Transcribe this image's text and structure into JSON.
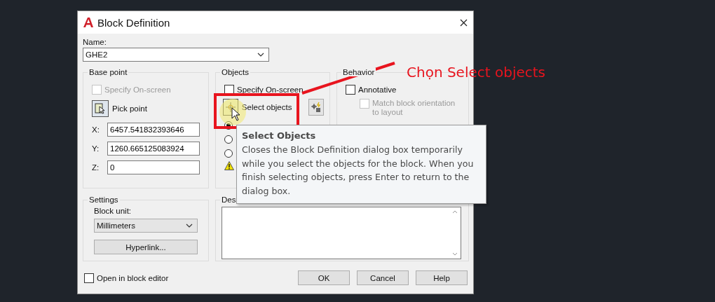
{
  "window": {
    "title": "Block Definition"
  },
  "name": {
    "label": "Name:",
    "value": "GHE2"
  },
  "base_point": {
    "title": "Base point",
    "specify_on_screen": {
      "label": "Specify On-screen",
      "checked": false,
      "disabled": true
    },
    "pick_button": "Pick point",
    "coords": [
      {
        "label": "X:",
        "value": "6457.541832393646"
      },
      {
        "label": "Y:",
        "value": "1260.665125083924"
      },
      {
        "label": "Z:",
        "value": "0"
      }
    ]
  },
  "objects": {
    "title": "Objects",
    "specify_on_screen": {
      "label": "Specify On-screen",
      "checked": false,
      "disabled": false
    },
    "select_button": "Select objects",
    "radios": [
      {
        "selected": true
      },
      {
        "selected": false
      },
      {
        "selected": false
      }
    ]
  },
  "behavior": {
    "title": "Behavior",
    "annotative": {
      "label": "Annotative",
      "checked": false,
      "disabled": false
    },
    "match_orientation": {
      "label": "Match block orientation to layout",
      "checked": false,
      "disabled": true
    }
  },
  "settings": {
    "title": "Settings",
    "unit_label": "Block unit:",
    "unit": "Millimeters",
    "hyperlink_button": "Hyperlink..."
  },
  "description": {
    "title": "Des"
  },
  "open_in_editor": {
    "label": "Open in block editor",
    "checked": false,
    "disabled": false
  },
  "buttons": [
    "OK",
    "Cancel",
    "Help"
  ],
  "tooltip": {
    "title": "Select Objects",
    "text": "Closes the Block Definition dialog box temporarily while you select the objects for the block. When you finish selecting objects, press Enter to return to the dialog box."
  },
  "annotation": {
    "text": "Chọn Select objects"
  }
}
